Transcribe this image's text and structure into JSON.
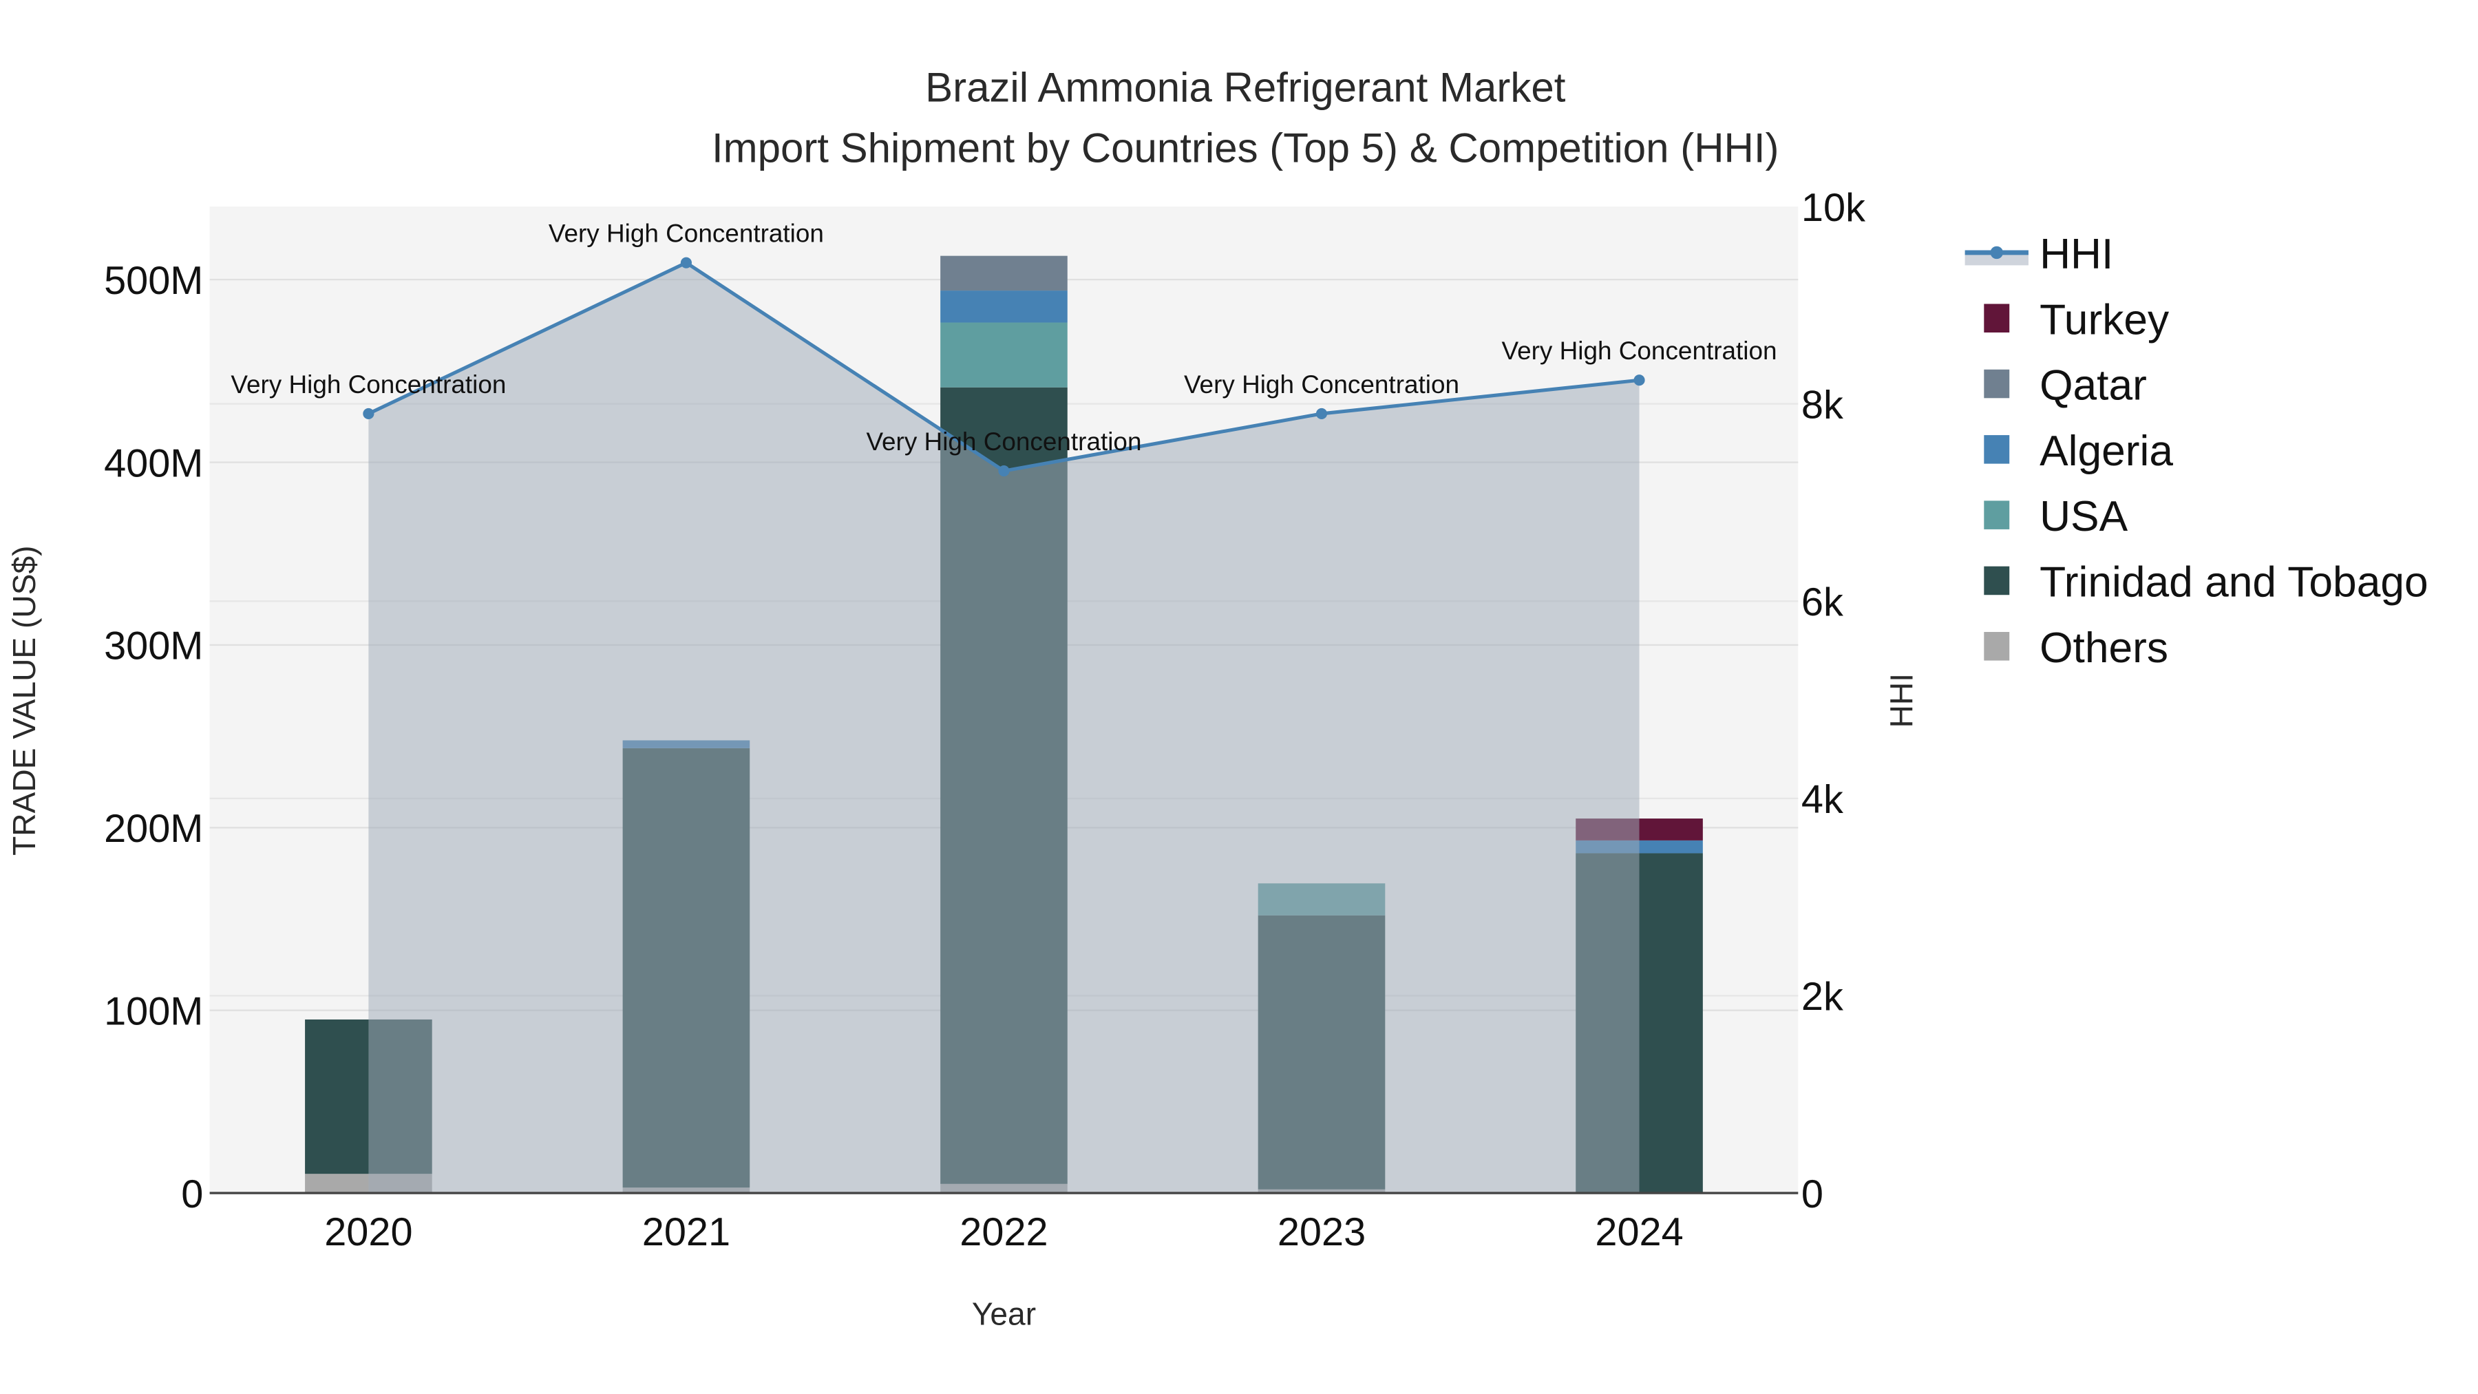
{
  "chart_data": {
    "type": "bar",
    "title": "Brazil Ammonia Refrigerant Market",
    "subtitle": "Import Shipment by Countries (Top 5) & Competition (HHI)",
    "xlabel": "Year",
    "ylabel": "TRADE VALUE (US$)",
    "y2label": "HHI",
    "categories": [
      "2020",
      "2021",
      "2022",
      "2023",
      "2024"
    ],
    "ylim": [
      0,
      540000000
    ],
    "y2lim": [
      0,
      10000
    ],
    "yticks": [
      0,
      100000000,
      200000000,
      300000000,
      400000000,
      500000000
    ],
    "ytick_labels": [
      "0",
      "100M",
      "200M",
      "300M",
      "400M",
      "500M"
    ],
    "y2ticks": [
      0,
      2000,
      4000,
      6000,
      8000,
      10000
    ],
    "y2tick_labels": [
      "0",
      "2k",
      "4k",
      "6k",
      "8k",
      "10k"
    ],
    "stacked": true,
    "series": [
      {
        "name": "Others",
        "color": "#a9a9a9",
        "values": [
          10500000,
          3000000,
          5000000,
          2000000,
          0
        ]
      },
      {
        "name": "Trinidad and Tobago",
        "color": "#2f4f4f",
        "values": [
          84500000,
          240500000,
          436000000,
          150000000,
          186000000
        ]
      },
      {
        "name": "USA",
        "color": "#5f9ea0",
        "values": [
          0,
          0,
          35500000,
          17500000,
          0
        ]
      },
      {
        "name": "Algeria",
        "color": "#4682b4",
        "values": [
          0,
          4300000,
          17500000,
          0,
          7000000
        ]
      },
      {
        "name": "Qatar",
        "color": "#708090",
        "values": [
          0,
          0,
          19000000,
          0,
          0
        ]
      },
      {
        "name": "Turkey",
        "color": "#611539",
        "values": [
          0,
          0,
          0,
          0,
          12000000
        ]
      }
    ],
    "hhi": {
      "name": "HHI",
      "color": "#4682b4",
      "values": [
        7900,
        9430,
        7320,
        7900,
        8240
      ],
      "annotations": [
        "Very High Concentration",
        "Very High Concentration",
        "Very High Concentration",
        "Very High Concentration",
        "Very High Concentration"
      ]
    },
    "legend": {
      "placement": "right",
      "items": [
        "HHI",
        "Turkey",
        "Qatar",
        "Algeria",
        "USA",
        "Trinidad and Tobago",
        "Others"
      ]
    },
    "grid": true
  }
}
